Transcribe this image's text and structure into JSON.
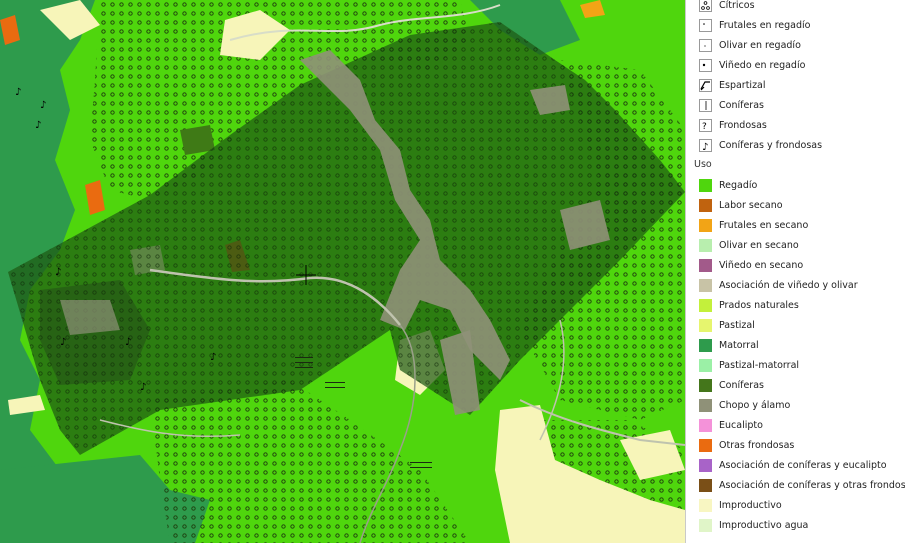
{
  "map": {
    "colors": {
      "regadio": "#4fd60d",
      "coniferas": "#3f7a16",
      "matorral": "#2e9b4c",
      "chopo": "#8f9178",
      "improductivo": "#f7f5b9",
      "overlay": "#1f5a13",
      "road": "#9aa08a"
    }
  },
  "legend": {
    "cultivos": [
      {
        "label": "Cítricos",
        "pattern": "dots-circles"
      },
      {
        "label": "Frutales en regadío",
        "pattern": "dot-single"
      },
      {
        "label": "Olivar en regadío",
        "pattern": "dot-small"
      },
      {
        "label": "Viñedo en regadío",
        "pattern": "dot-bold"
      },
      {
        "label": "Espartizal",
        "pattern": "esparto-icon"
      },
      {
        "label": "Coníferas",
        "pattern": "conifer-icon"
      },
      {
        "label": "Frondosas",
        "pattern": "broadleaf-icon"
      },
      {
        "label": "Coníferas y frondosas",
        "pattern": "mixed-tree-icon"
      }
    ],
    "uso_title": "Uso",
    "uso": [
      {
        "label": "Regadío",
        "color": "#4fd60d"
      },
      {
        "label": "Labor secano",
        "color": "#c0630f"
      },
      {
        "label": "Frutales en secano",
        "color": "#f2a416"
      },
      {
        "label": "Olivar en secano",
        "color": "#b8eeae"
      },
      {
        "label": "Viñedo en secano",
        "color": "#a25a8a"
      },
      {
        "label": "Asociación de viñedo y olivar",
        "color": "#c8c3a6"
      },
      {
        "label": "Prados naturales",
        "color": "#c3f03b"
      },
      {
        "label": "Pastizal",
        "color": "#e6f56e"
      },
      {
        "label": "Matorral",
        "color": "#2e9b4c"
      },
      {
        "label": "Pastizal-matorral",
        "color": "#9bf0a6"
      },
      {
        "label": "Coníferas",
        "color": "#44761b"
      },
      {
        "label": "Chopo y álamo",
        "color": "#8f9178"
      },
      {
        "label": "Eucalipto",
        "color": "#f492d9"
      },
      {
        "label": "Otras frondosas",
        "color": "#ea6b10"
      },
      {
        "label": "Asociación de coníferas y eucalipto",
        "color": "#a863c8"
      },
      {
        "label": "Asociación de coníferas y otras frondosas",
        "color": "#7a4f17"
      },
      {
        "label": "Improductivo",
        "color": "#f8f6c2"
      },
      {
        "label": "Improductivo agua",
        "color": "#e0f5c8"
      }
    ]
  }
}
